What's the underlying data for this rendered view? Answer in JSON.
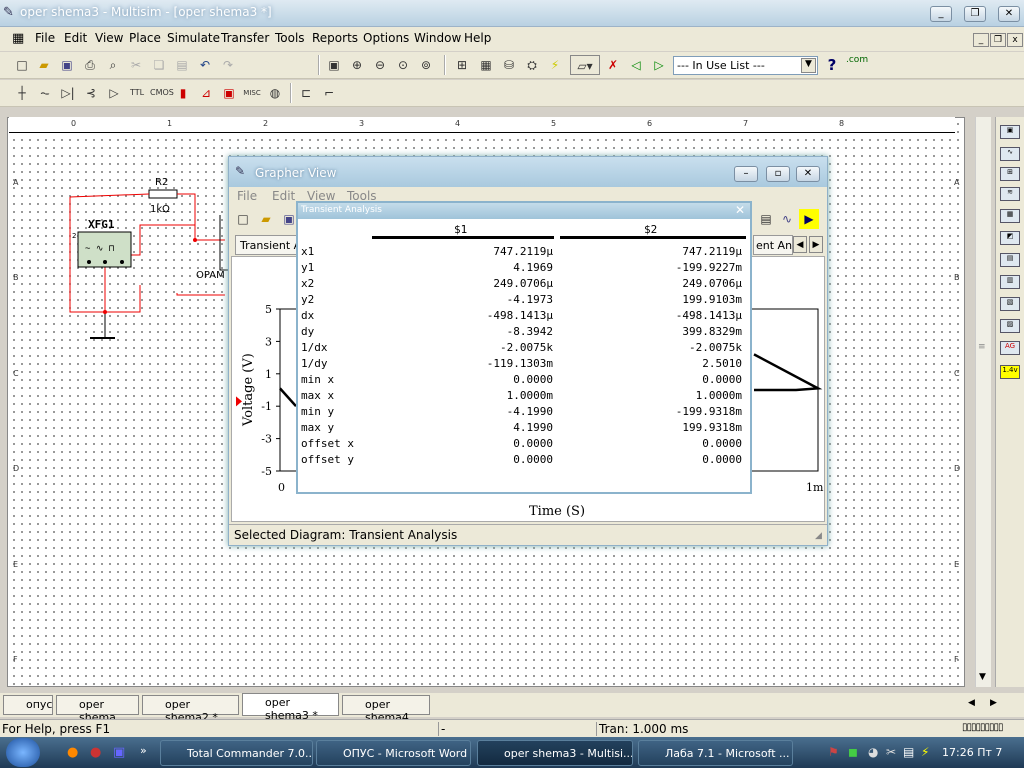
{
  "window": {
    "title": "oper shema3 - Multisim - [oper shema3 *]"
  },
  "menu": [
    "File",
    "Edit",
    "View",
    "Place",
    "Simulate",
    "Transfer",
    "Tools",
    "Reports",
    "Options",
    "Window",
    "Help"
  ],
  "toolbar": {
    "in_use_list": "--- In Use List ---",
    "help_q": "?",
    "com": ".com"
  },
  "ruler": {
    "cols": [
      "0",
      "1",
      "2",
      "3",
      "4",
      "5",
      "6",
      "7",
      "8"
    ],
    "rows": [
      "A",
      "B",
      "C",
      "D",
      "E",
      "F"
    ]
  },
  "schematic": {
    "r2_name": "R2",
    "r2_value": "1kΩ",
    "xfg_name": "XFG1",
    "opamp_label": "OPAM",
    "pin2": "2"
  },
  "grapher": {
    "title": "Grapher View",
    "menu": [
      "File",
      "Edit",
      "View",
      "Tools"
    ],
    "tab_left": "Transient Ana",
    "tab_right": "ent Ana",
    "selected_diagram": "Selected Diagram:  Transient Analysis"
  },
  "chart_data": {
    "type": "line",
    "xlabel": "Time (S)",
    "ylabel": "Voltage (V)",
    "y_ticks": [
      "5",
      "3",
      "1",
      "-1",
      "-3",
      "-5"
    ],
    "x_ticks": [
      "0",
      "1m"
    ],
    "ylim": [
      -5,
      5
    ]
  },
  "transient": {
    "title": "Transient Analysis",
    "col1": "$1",
    "col2": "$2",
    "rows": [
      {
        "label": "x1",
        "c1": "747.2119µ",
        "c2": "747.2119µ"
      },
      {
        "label": "y1",
        "c1": "4.1969",
        "c2": "-199.9227m"
      },
      {
        "label": "x2",
        "c1": "249.0706µ",
        "c2": "249.0706µ"
      },
      {
        "label": "y2",
        "c1": "-4.1973",
        "c2": "199.9103m"
      },
      {
        "label": "dx",
        "c1": "-498.1413µ",
        "c2": "-498.1413µ"
      },
      {
        "label": "dy",
        "c1": "-8.3942",
        "c2": "399.8329m"
      },
      {
        "label": "1/dx",
        "c1": "-2.0075k",
        "c2": "-2.0075k"
      },
      {
        "label": "1/dy",
        "c1": "-119.1303m",
        "c2": "2.5010"
      },
      {
        "label": "min x",
        "c1": "0.0000",
        "c2": "0.0000"
      },
      {
        "label": "max x",
        "c1": "1.0000m",
        "c2": "1.0000m"
      },
      {
        "label": "min y",
        "c1": "-4.1990",
        "c2": "-199.9318m"
      },
      {
        "label": "max y",
        "c1": "4.1990",
        "c2": "199.9318m"
      },
      {
        "label": "offset x",
        "c1": "0.0000",
        "c2": "0.0000"
      },
      {
        "label": "offset y",
        "c1": "0.0000",
        "c2": "0.0000"
      }
    ]
  },
  "tabs": [
    "опус",
    "oper shema",
    "oper shema2 *",
    "oper shema3 *",
    "oper shema4"
  ],
  "status": {
    "help": "For Help, press F1",
    "dash": "-",
    "tran": "Tran: 1.000 ms"
  },
  "taskbar": {
    "items": [
      "Total Commander 7.0...",
      "ОПУС - Microsoft Word",
      "oper shema3 - Multisi...",
      "Лаба 7.1 - Microsoft ..."
    ],
    "clock": "17:26 Пт 7"
  }
}
